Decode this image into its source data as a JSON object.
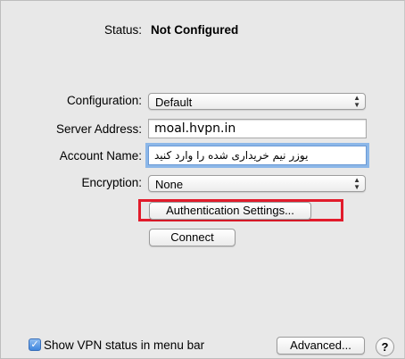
{
  "status": {
    "label": "Status:",
    "value": "Not Configured"
  },
  "configuration": {
    "label": "Configuration:",
    "selected": "Default"
  },
  "server_address": {
    "label": "Server Address:",
    "value": "moal.hvpn.in"
  },
  "account_name": {
    "label": "Account Name:",
    "value": "یوزر نیم خریداری شده را وارد کنید"
  },
  "encryption": {
    "label": "Encryption:",
    "selected": "None"
  },
  "buttons": {
    "authentication_settings": "Authentication Settings...",
    "connect": "Connect",
    "advanced": "Advanced...",
    "help": "?"
  },
  "show_vpn_status": {
    "label": "Show VPN status in menu bar",
    "checked": true
  },
  "colors": {
    "highlight_box": "#e11b2b",
    "focus_ring": "#8cb7e8",
    "checkbox": "#3f86dd"
  },
  "icons": {
    "popup_arrows": "up-down-arrows-icon",
    "checkmark": "checkmark-icon"
  }
}
